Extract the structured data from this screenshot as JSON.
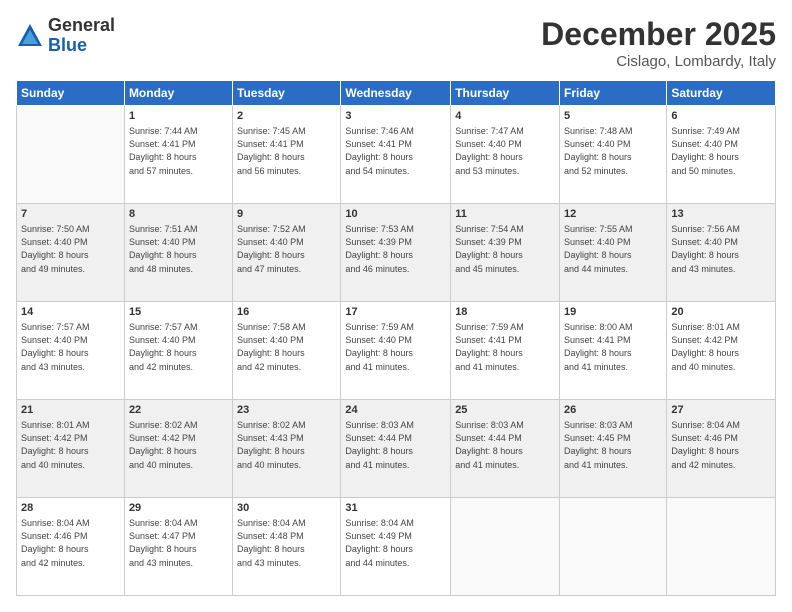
{
  "logo": {
    "general": "General",
    "blue": "Blue"
  },
  "title": "December 2025",
  "location": "Cislago, Lombardy, Italy",
  "headers": [
    "Sunday",
    "Monday",
    "Tuesday",
    "Wednesday",
    "Thursday",
    "Friday",
    "Saturday"
  ],
  "weeks": [
    {
      "shaded": false,
      "days": [
        {
          "num": "",
          "info": ""
        },
        {
          "num": "1",
          "info": "Sunrise: 7:44 AM\nSunset: 4:41 PM\nDaylight: 8 hours\nand 57 minutes."
        },
        {
          "num": "2",
          "info": "Sunrise: 7:45 AM\nSunset: 4:41 PM\nDaylight: 8 hours\nand 56 minutes."
        },
        {
          "num": "3",
          "info": "Sunrise: 7:46 AM\nSunset: 4:41 PM\nDaylight: 8 hours\nand 54 minutes."
        },
        {
          "num": "4",
          "info": "Sunrise: 7:47 AM\nSunset: 4:40 PM\nDaylight: 8 hours\nand 53 minutes."
        },
        {
          "num": "5",
          "info": "Sunrise: 7:48 AM\nSunset: 4:40 PM\nDaylight: 8 hours\nand 52 minutes."
        },
        {
          "num": "6",
          "info": "Sunrise: 7:49 AM\nSunset: 4:40 PM\nDaylight: 8 hours\nand 50 minutes."
        }
      ]
    },
    {
      "shaded": true,
      "days": [
        {
          "num": "7",
          "info": "Sunrise: 7:50 AM\nSunset: 4:40 PM\nDaylight: 8 hours\nand 49 minutes."
        },
        {
          "num": "8",
          "info": "Sunrise: 7:51 AM\nSunset: 4:40 PM\nDaylight: 8 hours\nand 48 minutes."
        },
        {
          "num": "9",
          "info": "Sunrise: 7:52 AM\nSunset: 4:40 PM\nDaylight: 8 hours\nand 47 minutes."
        },
        {
          "num": "10",
          "info": "Sunrise: 7:53 AM\nSunset: 4:39 PM\nDaylight: 8 hours\nand 46 minutes."
        },
        {
          "num": "11",
          "info": "Sunrise: 7:54 AM\nSunset: 4:39 PM\nDaylight: 8 hours\nand 45 minutes."
        },
        {
          "num": "12",
          "info": "Sunrise: 7:55 AM\nSunset: 4:40 PM\nDaylight: 8 hours\nand 44 minutes."
        },
        {
          "num": "13",
          "info": "Sunrise: 7:56 AM\nSunset: 4:40 PM\nDaylight: 8 hours\nand 43 minutes."
        }
      ]
    },
    {
      "shaded": false,
      "days": [
        {
          "num": "14",
          "info": "Sunrise: 7:57 AM\nSunset: 4:40 PM\nDaylight: 8 hours\nand 43 minutes."
        },
        {
          "num": "15",
          "info": "Sunrise: 7:57 AM\nSunset: 4:40 PM\nDaylight: 8 hours\nand 42 minutes."
        },
        {
          "num": "16",
          "info": "Sunrise: 7:58 AM\nSunset: 4:40 PM\nDaylight: 8 hours\nand 42 minutes."
        },
        {
          "num": "17",
          "info": "Sunrise: 7:59 AM\nSunset: 4:40 PM\nDaylight: 8 hours\nand 41 minutes."
        },
        {
          "num": "18",
          "info": "Sunrise: 7:59 AM\nSunset: 4:41 PM\nDaylight: 8 hours\nand 41 minutes."
        },
        {
          "num": "19",
          "info": "Sunrise: 8:00 AM\nSunset: 4:41 PM\nDaylight: 8 hours\nand 41 minutes."
        },
        {
          "num": "20",
          "info": "Sunrise: 8:01 AM\nSunset: 4:42 PM\nDaylight: 8 hours\nand 40 minutes."
        }
      ]
    },
    {
      "shaded": true,
      "days": [
        {
          "num": "21",
          "info": "Sunrise: 8:01 AM\nSunset: 4:42 PM\nDaylight: 8 hours\nand 40 minutes."
        },
        {
          "num": "22",
          "info": "Sunrise: 8:02 AM\nSunset: 4:42 PM\nDaylight: 8 hours\nand 40 minutes."
        },
        {
          "num": "23",
          "info": "Sunrise: 8:02 AM\nSunset: 4:43 PM\nDaylight: 8 hours\nand 40 minutes."
        },
        {
          "num": "24",
          "info": "Sunrise: 8:03 AM\nSunset: 4:44 PM\nDaylight: 8 hours\nand 41 minutes."
        },
        {
          "num": "25",
          "info": "Sunrise: 8:03 AM\nSunset: 4:44 PM\nDaylight: 8 hours\nand 41 minutes."
        },
        {
          "num": "26",
          "info": "Sunrise: 8:03 AM\nSunset: 4:45 PM\nDaylight: 8 hours\nand 41 minutes."
        },
        {
          "num": "27",
          "info": "Sunrise: 8:04 AM\nSunset: 4:46 PM\nDaylight: 8 hours\nand 42 minutes."
        }
      ]
    },
    {
      "shaded": false,
      "days": [
        {
          "num": "28",
          "info": "Sunrise: 8:04 AM\nSunset: 4:46 PM\nDaylight: 8 hours\nand 42 minutes."
        },
        {
          "num": "29",
          "info": "Sunrise: 8:04 AM\nSunset: 4:47 PM\nDaylight: 8 hours\nand 43 minutes."
        },
        {
          "num": "30",
          "info": "Sunrise: 8:04 AM\nSunset: 4:48 PM\nDaylight: 8 hours\nand 43 minutes."
        },
        {
          "num": "31",
          "info": "Sunrise: 8:04 AM\nSunset: 4:49 PM\nDaylight: 8 hours\nand 44 minutes."
        },
        {
          "num": "",
          "info": ""
        },
        {
          "num": "",
          "info": ""
        },
        {
          "num": "",
          "info": ""
        }
      ]
    }
  ]
}
